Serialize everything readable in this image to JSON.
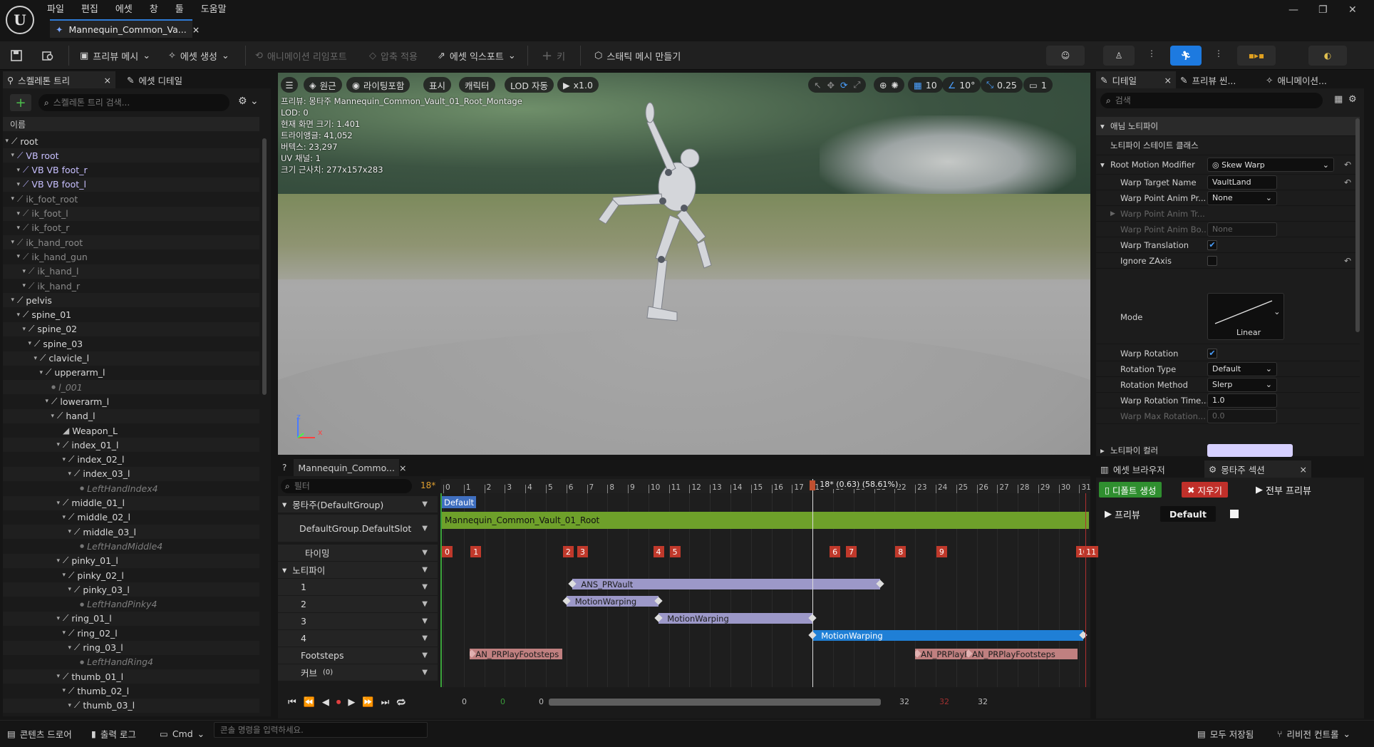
{
  "menu": [
    "파일",
    "편집",
    "에셋",
    "창",
    "툴",
    "도움말"
  ],
  "document_tab": "Mannequin_Common_Va...",
  "toolbar": {
    "preview_mesh": "프리뷰 메시",
    "create_asset": "에셋 생성",
    "reimport": "애니메이션 리임포트",
    "apply_compression": "압축 적용",
    "export_asset": "에셋 익스포트",
    "key": "키",
    "make_static_mesh": "스태틱 메시 만들기"
  },
  "skeleton_panel": {
    "tab": "스켈레톤 트리",
    "tab2": "에셋 디테일",
    "search_placeholder": "스켈레톤 트리 검색...",
    "header": "이름",
    "bones": [
      {
        "name": "root",
        "depth": 0,
        "type": "bone"
      },
      {
        "name": "VB root",
        "depth": 1,
        "type": "vb"
      },
      {
        "name": "VB VB foot_r",
        "depth": 2,
        "type": "vb"
      },
      {
        "name": "VB VB foot_l",
        "depth": 2,
        "type": "vb"
      },
      {
        "name": "ik_foot_root",
        "depth": 1,
        "type": "dim"
      },
      {
        "name": "ik_foot_l",
        "depth": 2,
        "type": "dim"
      },
      {
        "name": "ik_foot_r",
        "depth": 2,
        "type": "dim"
      },
      {
        "name": "ik_hand_root",
        "depth": 1,
        "type": "dim"
      },
      {
        "name": "ik_hand_gun",
        "depth": 2,
        "type": "dim"
      },
      {
        "name": "ik_hand_l",
        "depth": 3,
        "type": "dim"
      },
      {
        "name": "ik_hand_r",
        "depth": 3,
        "type": "dim"
      },
      {
        "name": "pelvis",
        "depth": 1,
        "type": "bone"
      },
      {
        "name": "spine_01",
        "depth": 2,
        "type": "bone"
      },
      {
        "name": "spine_02",
        "depth": 3,
        "type": "bone"
      },
      {
        "name": "spine_03",
        "depth": 4,
        "type": "bone"
      },
      {
        "name": "clavicle_l",
        "depth": 5,
        "type": "bone"
      },
      {
        "name": "upperarm_l",
        "depth": 6,
        "type": "bone"
      },
      {
        "name": "l_001",
        "depth": 7,
        "type": "socket"
      },
      {
        "name": "lowerarm_l",
        "depth": 7,
        "type": "bone"
      },
      {
        "name": "hand_l",
        "depth": 8,
        "type": "bone"
      },
      {
        "name": "Weapon_L",
        "depth": 9,
        "type": "mesh"
      },
      {
        "name": "index_01_l",
        "depth": 9,
        "type": "bone"
      },
      {
        "name": "index_02_l",
        "depth": 10,
        "type": "bone"
      },
      {
        "name": "index_03_l",
        "depth": 11,
        "type": "bone"
      },
      {
        "name": "LeftHandIndex4",
        "depth": 12,
        "type": "socket"
      },
      {
        "name": "middle_01_l",
        "depth": 9,
        "type": "bone"
      },
      {
        "name": "middle_02_l",
        "depth": 10,
        "type": "bone"
      },
      {
        "name": "middle_03_l",
        "depth": 11,
        "type": "bone"
      },
      {
        "name": "LeftHandMiddle4",
        "depth": 12,
        "type": "socket"
      },
      {
        "name": "pinky_01_l",
        "depth": 9,
        "type": "bone"
      },
      {
        "name": "pinky_02_l",
        "depth": 10,
        "type": "bone"
      },
      {
        "name": "pinky_03_l",
        "depth": 11,
        "type": "bone"
      },
      {
        "name": "LeftHandPinky4",
        "depth": 12,
        "type": "socket"
      },
      {
        "name": "ring_01_l",
        "depth": 9,
        "type": "bone"
      },
      {
        "name": "ring_02_l",
        "depth": 10,
        "type": "bone"
      },
      {
        "name": "ring_03_l",
        "depth": 11,
        "type": "bone"
      },
      {
        "name": "LeftHandRing4",
        "depth": 12,
        "type": "socket"
      },
      {
        "name": "thumb_01_l",
        "depth": 9,
        "type": "bone"
      },
      {
        "name": "thumb_02_l",
        "depth": 10,
        "type": "bone"
      },
      {
        "name": "thumb_03_l",
        "depth": 11,
        "type": "bone"
      }
    ]
  },
  "viewport": {
    "buttons": [
      "원근",
      "라이팅포함",
      "표시",
      "캐릭터",
      "LOD 자동",
      "x1.0"
    ],
    "grid_value": "10",
    "angle_value": "10°",
    "scale_value": "0.25",
    "camera_value": "1",
    "stats": [
      "프리뷰: 몽타주 Mannequin_Common_Vault_01_Root_Montage",
      "LOD: 0",
      "현재 화면 크기: 1.401",
      "트라이앵글: 41,052",
      "버텍스: 23,297",
      "UV 채널: 1",
      "크기 근사치: 277x157x283"
    ],
    "axis_x": "x",
    "axis_z": "z"
  },
  "details": {
    "tabs": [
      "디테일",
      "프리뷰 씬...",
      "애니메이션..."
    ],
    "search_placeholder": "검색",
    "category": "애님 노티파이",
    "notify_class_label": "노티파이 스테이트 클래스",
    "root_motion_modifier": {
      "label": "Root Motion Modifier",
      "value": "Skew Warp"
    },
    "rows": [
      {
        "name": "Warp Target Name",
        "value": "VaultLand",
        "kind": "field"
      },
      {
        "name": "Warp Point Anim Pr...",
        "value": "None",
        "kind": "dropdown"
      },
      {
        "name": "Warp Point Anim Tr...",
        "value": "",
        "kind": "disabled-expand"
      },
      {
        "name": "Warp Point Anim Bo...",
        "value": "None",
        "kind": "disabled"
      },
      {
        "name": "Warp Translation",
        "value": "true",
        "kind": "check"
      },
      {
        "name": "Ignore ZAxis",
        "value": "false",
        "kind": "check"
      }
    ],
    "mode": {
      "label": "Mode",
      "value": "Linear"
    },
    "rows2": [
      {
        "name": "Warp Rotation",
        "value": "true",
        "kind": "check"
      },
      {
        "name": "Rotation Type",
        "value": "Default",
        "kind": "dropdown"
      },
      {
        "name": "Rotation Method",
        "value": "Slerp",
        "kind": "dropdown"
      },
      {
        "name": "Warp Rotation Time...",
        "value": "1.0",
        "kind": "field"
      },
      {
        "name": "Warp Max Rotation...",
        "value": "0.0",
        "kind": "disabled"
      }
    ],
    "notify_color_label": "노티파이 컬러",
    "notify_color": "#d6d0ff"
  },
  "montage_sections": {
    "tabs": [
      "에셋 브라우저",
      "몽타주 섹션"
    ],
    "create_default": "디폴트 생성",
    "clear": "지우기",
    "preview_all": "전부 프리뷰",
    "preview": "프리뷰",
    "default_section": "Default"
  },
  "timeline": {
    "tab": "Mannequin_Commo...",
    "filter_placeholder": "필터",
    "frame_badge": "18*",
    "playhead_label": "18* (0.63) (58.61%)",
    "ticks": [
      "0",
      "1",
      "2",
      "3",
      "4",
      "5",
      "6",
      "7",
      "8",
      "9",
      "10",
      "11",
      "12",
      "13",
      "14",
      "15",
      "16",
      "17",
      "18",
      "19",
      "20",
      "21",
      "22",
      "23",
      "24",
      "25",
      "26",
      "27",
      "28",
      "29",
      "30",
      "31"
    ],
    "tracks": {
      "montage_group": "몽타주(DefaultGroup)",
      "slot": "DefaultGroup.DefaultSlot",
      "timing": "타이밍",
      "notifies": "노티파이",
      "notify_rows": [
        "1",
        "2",
        "3",
        "4"
      ],
      "footsteps": "Footsteps",
      "curves": "커브",
      "curves_count": "(0)"
    },
    "section_label": "Default",
    "segment_label": "Mannequin_Common_Vault_01_Root",
    "timing_markers": [
      "0",
      "1",
      "2",
      "3",
      "4",
      "5",
      "6",
      "7",
      "8",
      "9",
      "10",
      "11"
    ],
    "notifies": [
      {
        "label": "ANS_PRVault",
        "row": 0,
        "start": 6.3,
        "end": 21.3
      },
      {
        "label": "MotionWarping",
        "row": 1,
        "start": 6.0,
        "end": 10.5
      },
      {
        "label": "MotionWarping",
        "row": 2,
        "start": 10.5,
        "end": 18.0
      },
      {
        "label": "MotionWarping",
        "row": 3,
        "start": 18.0,
        "end": 31.2
      }
    ],
    "footsteps": [
      {
        "label": "AN_PRPlayFootsteps",
        "at": 1.3,
        "end": 5.8
      },
      {
        "label": "AN_PRPlayFoc",
        "at": 23.0,
        "end": 26.6
      },
      {
        "label": "AN_PRPlayFootsteps",
        "at": 25.5,
        "end": 30.9
      }
    ],
    "bottom": {
      "start": "0",
      "green": "0",
      "cur": "0",
      "end": "32",
      "red": "32",
      "end2": "32"
    }
  },
  "statusbar": {
    "content_drawer": "콘텐츠 드로어",
    "output_log": "출력 로그",
    "cmd": "Cmd",
    "console_placeholder": "콘솔 명령을 입력하세요.",
    "save_all": "모두 저장됨",
    "revision_control": "리비전 컨트롤"
  }
}
